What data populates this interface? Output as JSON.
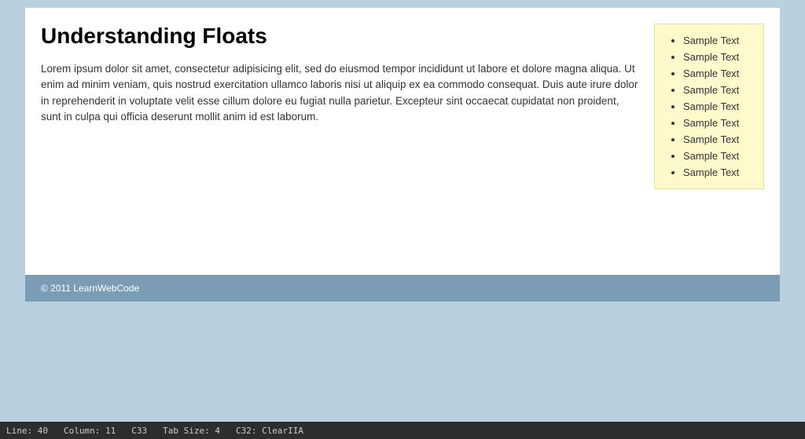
{
  "page": {
    "title": "Understanding Floats",
    "body_text": "Lorem ipsum dolor sit amet, consectetur adipisicing elit, sed do eiusmod tempor incididunt ut labore et dolore magna aliqua. Ut enim ad minim veniam, quis nostrud exercitation ullamco laboris nisi ut aliquip ex ea commodo consequat. Duis aute irure dolor in reprehenderit in voluptate velit esse cillum dolore eu fugiat nulla parietur. Excepteur sint occaecat cupidatat non proident, sunt in culpa qui officia deserunt mollit anim id est laborum."
  },
  "float_list": {
    "items": [
      "Sample Text",
      "Sample Text",
      "Sample Text",
      "Sample Text",
      "Sample Text",
      "Sample Text",
      "Sample Text",
      "Sample Text",
      "Sample Text"
    ]
  },
  "footer": {
    "copyright": "© 2011 LearnWebCode"
  },
  "statusbar": {
    "line": "Line: 40",
    "column": "Column: 11",
    "code1": "C33",
    "tab_size": "Tab Size: 4",
    "code2": "C32: ClearIIA"
  }
}
